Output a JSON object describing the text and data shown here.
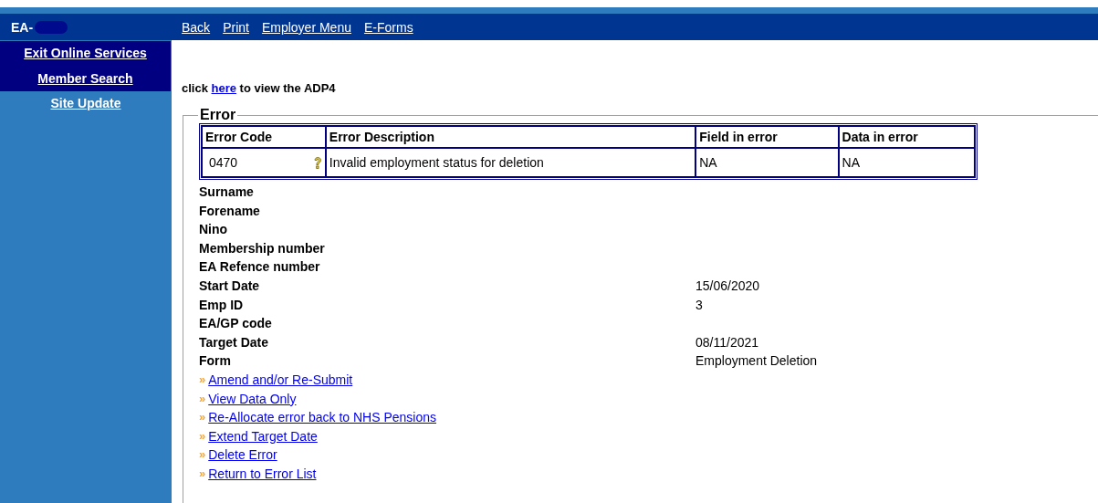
{
  "header": {
    "title": "EA-",
    "redacted": true,
    "nav": [
      "Back",
      "Print",
      "Employer Menu",
      "E-Forms"
    ]
  },
  "sidebar": {
    "items": [
      {
        "label": "Exit Online Services",
        "kind": "primary"
      },
      {
        "label": "Member Search",
        "kind": "primary"
      },
      {
        "label": "Site Update",
        "kind": "secondary"
      }
    ]
  },
  "intro": {
    "before": "click",
    "link": "here",
    "after": "to view the ADP4"
  },
  "error": {
    "legend": "Error",
    "table": {
      "columns": [
        "Error Code",
        "Error Description",
        "Field in error",
        "Data in error"
      ],
      "rows": [
        {
          "cells": [
            "0470",
            "Invalid employment status for deletion",
            "NA",
            "NA"
          ],
          "help": true
        }
      ]
    },
    "details": [
      {
        "label": "Surname"
      },
      {
        "label": "Forename"
      },
      {
        "label": "Nino"
      },
      {
        "label": "Membership number"
      },
      {
        "label": "EA Refence number"
      },
      {
        "label": "Start Date",
        "value": "15/06/2020"
      },
      {
        "label": "Emp ID",
        "value": "3"
      },
      {
        "label": "EA/GP code"
      },
      {
        "label": "Target Date",
        "value": "08/11/2021"
      },
      {
        "label": "Form",
        "value": "Employment Deletion"
      }
    ],
    "actions": [
      {
        "marker": "»",
        "label": "Amend and/or Re-Submit"
      },
      {
        "marker": "»",
        "label": "View Data Only"
      },
      {
        "marker": "»",
        "label": "Re-Allocate error back to NHS Pensions"
      },
      {
        "marker": "»",
        "label": "Extend Target Date"
      },
      {
        "marker": "»",
        "label": "Delete Error"
      },
      {
        "marker": "»",
        "label": "Return to Error List"
      }
    ]
  }
}
